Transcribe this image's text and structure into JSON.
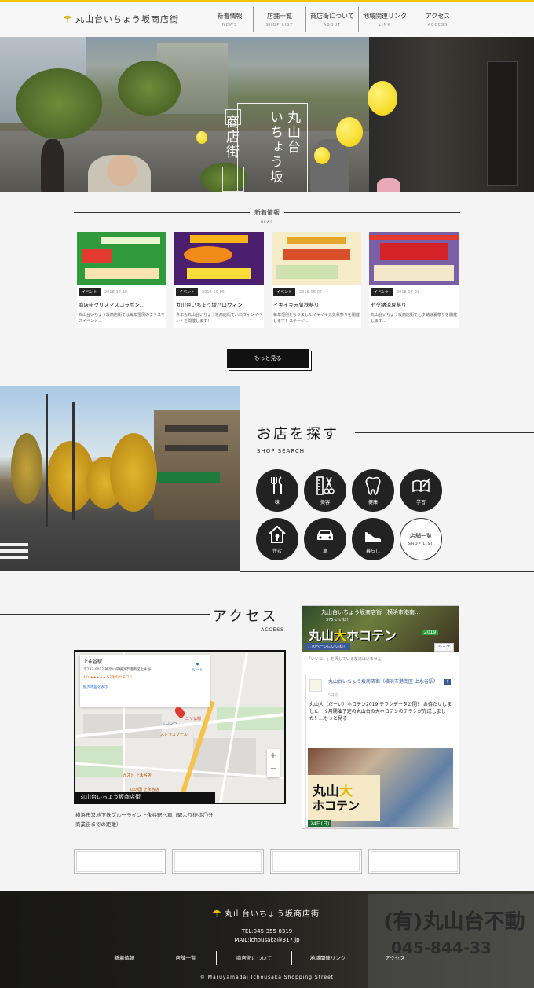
{
  "header": {
    "logo_text": "丸山台いちょう坂商店街",
    "nav": [
      {
        "jp": "新着情報",
        "en": "NEWS"
      },
      {
        "jp": "店舗一覧",
        "en": "SHOP LIST"
      },
      {
        "jp": "商店街について",
        "en": "ABOUT"
      },
      {
        "jp": "地域関連リンク",
        "en": "LINK"
      },
      {
        "jp": "アクセス",
        "en": "ACCESS"
      }
    ]
  },
  "hero": {
    "title_col1": "丸山台",
    "title_col2": "いちょう坂",
    "title_col3": "商店街"
  },
  "news": {
    "title_jp": "新着情報",
    "title_en": "NEWS",
    "cards": [
      {
        "badge": "イベント",
        "date": "2018-12-10",
        "title": "商店街クリスマスコラボン…",
        "excerpt": "丸山台いちょう坂商店街では毎年恒例のクリスマスイベント…"
      },
      {
        "badge": "イベント",
        "date": "2018-10-05",
        "title": "丸山台いちょう坂ハロウィン",
        "excerpt": "今年も丸山台いちょう坂商店街でハロウィンイベントを開催します！"
      },
      {
        "badge": "イベント",
        "date": "2018-08-07",
        "title": "イキイキ元気秋祭り",
        "excerpt": "毎年恒例となりましたイキイキ元気秋祭りを開催します！ステージ…"
      },
      {
        "badge": "イベント",
        "date": "2018-07-03",
        "title": "七夕納涼夏祭り",
        "excerpt": "丸山台いちょう坂商店街で七夕納涼夏祭りを開催します…"
      }
    ],
    "more_label": "もっと見る"
  },
  "shop_search": {
    "title_jp": "お店を探す",
    "title_en": "SHOP SEARCH",
    "categories": [
      {
        "icon": "fork-knife-icon",
        "label": "味"
      },
      {
        "icon": "scissors-comb-icon",
        "label": "美容"
      },
      {
        "icon": "tooth-icon",
        "label": "健康"
      },
      {
        "icon": "book-pen-icon",
        "label": "学習"
      },
      {
        "icon": "house-icon",
        "label": "住む"
      },
      {
        "icon": "car-icon",
        "label": "車"
      },
      {
        "icon": "shoe-icon",
        "label": "暮らし"
      }
    ],
    "list_label": "店舗一覧",
    "list_sub": "SHOP LIST"
  },
  "access": {
    "title_jp": "アクセス",
    "title_en": "ACCESS",
    "map": {
      "place_name": "上永谷駅",
      "place_address": "〒233-0012 神奈川県横浜市港南区上永谷…",
      "rating_text": "4.0 ★★★★★ 57件のクチコミ",
      "link_text": "拡大地図を表示",
      "directions": "ルート",
      "save": "保存",
      "label_1": "ニヤ仏場",
      "label_2": "ミコンベ",
      "label_3": "ストラスプール",
      "label_4": "ガスト 上永谷店",
      "label_5": "ほの国 上永谷店",
      "zoom_in": "+",
      "zoom_out": "−",
      "caption": "丸山台いちょう坂商店街"
    },
    "address_text": "横浜市営地下鉄ブルーライン上永谷駅へ車（駅より徒歩〇分商業街までの距離）"
  },
  "facebook": {
    "page_name": "丸山台いちょう坂商店街（横浜市港南…",
    "cover_sub": "575 いいね！",
    "cover_big_1": "丸山",
    "cover_big_2": "大",
    "cover_big_3": "ホコテン",
    "cover_year": "2019",
    "like_label": "このページにいいね！",
    "share_label": "シェア",
    "count_text": "「いいね！」を押している友達はいません",
    "post_name": "丸山台いちょう坂商店街（横浜市港南区 上永谷駅）",
    "post_date": "5日前",
    "post_text": "丸山大（だーい）ホコテン2019 チラシデータ公開！ お待たせしました！ 9月開催予定の丸山台の大ホコテンのチラシが完成しました！…もっと見る",
    "img_big_1": "丸山",
    "img_big_2": "大",
    "img_big_3": "ホコテン",
    "img_date": "24日(日)"
  },
  "footer": {
    "logo_text": "丸山台いちょう坂商店街",
    "tel": "TEL:045-355-0319",
    "mail": "MAIL:ichousaka@317.jp",
    "nav": [
      "新着情報",
      "店舗一覧",
      "商店街について",
      "地域関連リンク",
      "アクセス"
    ],
    "copyright": "© Maruyamadai Ichousaka Shopping Street",
    "sign_text": "(有)丸山台不動",
    "sign_phone": "045-844-33"
  },
  "colors": {
    "accent": "#f5c400",
    "dark": "#222222"
  }
}
